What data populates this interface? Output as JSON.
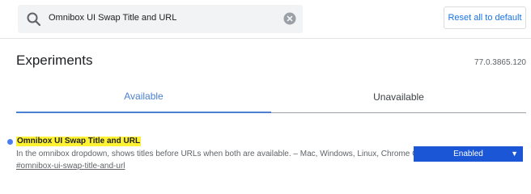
{
  "search": {
    "value": "Omnibox UI Swap Title and URL"
  },
  "header": {
    "reset_label": "Reset all to default"
  },
  "main": {
    "title": "Experiments",
    "version": "77.0.3865.120",
    "tabs": [
      {
        "label": "Available",
        "active": true
      },
      {
        "label": "Unavailable",
        "active": false
      }
    ]
  },
  "experiment": {
    "title": "Omnibox UI Swap Title and URL",
    "description": "In the omnibox dropdown, shows titles before URLs when both are available. – Mac, Windows, Linux, Chrome OS",
    "link": "#omnibox-ui-swap-title-and-url",
    "selected": "Enabled"
  },
  "colors": {
    "accent": "#1a73e8",
    "highlight": "#fff233",
    "select_bg": "#1a56d6"
  },
  "icons": {
    "search": "search-icon",
    "clear": "clear-icon",
    "dropdown": "chevron-down-icon"
  }
}
